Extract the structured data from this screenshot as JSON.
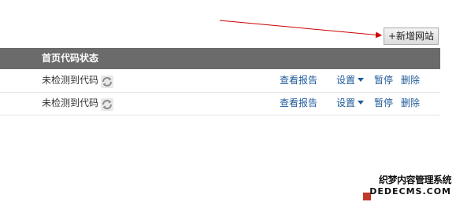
{
  "toolbar": {
    "add_site_label": "+新增网站"
  },
  "table": {
    "header": {
      "code_status": "首页代码状态"
    },
    "rows": [
      {
        "status": "未检测到代码",
        "view_report": "查看报告",
        "settings": "设置",
        "pause": "暂停",
        "delete": "删除"
      },
      {
        "status": "未检测到代码",
        "view_report": "查看报告",
        "settings": "设置",
        "pause": "暂停",
        "delete": "删除"
      }
    ]
  },
  "annotation": {
    "arrow_color": "#cc0000"
  },
  "watermark": {
    "line1": "织梦内容管理系统",
    "line2": "DEDECMS.COM"
  },
  "colors": {
    "header_bg": "#6b6b6b",
    "link": "#1f5a99"
  }
}
